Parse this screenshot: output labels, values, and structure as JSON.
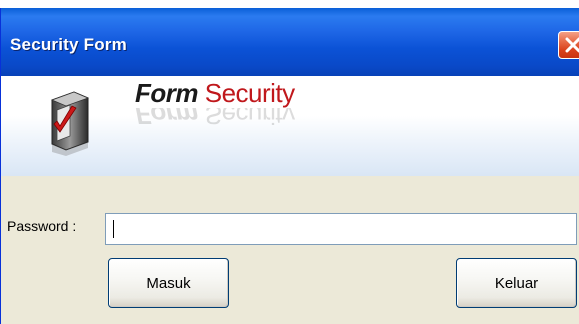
{
  "window": {
    "title": "Security Form"
  },
  "banner": {
    "title_part1": "Form",
    "title_part2": "Security"
  },
  "form": {
    "password_label": "Password :",
    "password_value": "",
    "submit_label": "Masuk",
    "exit_label": "Keluar"
  },
  "icons": {
    "close": "close-icon",
    "logo": "security-checkmark-icon"
  },
  "colors": {
    "titlebar": "#0a49c8",
    "close_button": "#d9411c",
    "title_accent": "#c0181c",
    "window_bg": "#ece9d8"
  }
}
